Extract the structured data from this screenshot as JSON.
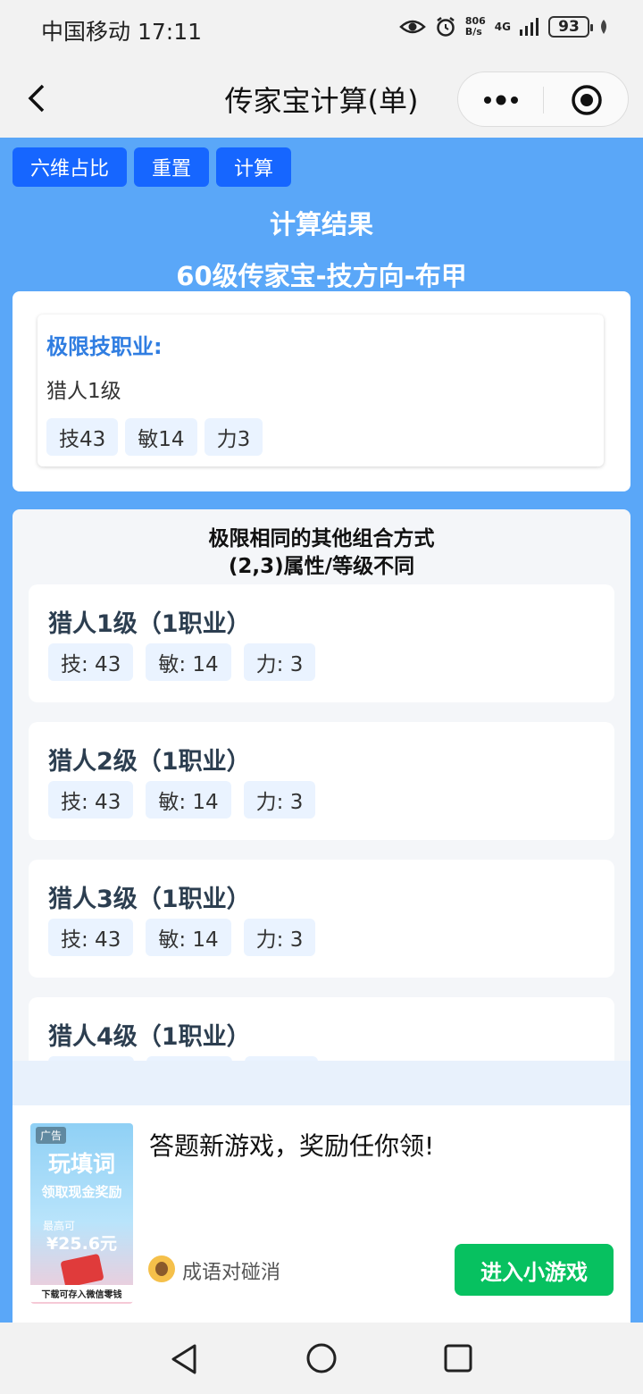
{
  "status_bar": {
    "carrier": "中国移动",
    "time": "17:11",
    "net_speed_value": "806",
    "net_speed_unit": "B/s",
    "network": "4G",
    "battery": "93"
  },
  "title_bar": {
    "title": "传家宝计算(单)"
  },
  "toolbar": {
    "six_dim_label": "六维占比",
    "reset_label": "重置",
    "calc_label": "计算"
  },
  "result": {
    "title": "计算结果",
    "subtitle": "60级传家宝-技方向-布甲"
  },
  "extreme": {
    "label": "极限技职业:",
    "class_name": "猎人1级",
    "stats": [
      "技43",
      "敏14",
      "力3"
    ]
  },
  "combos": {
    "title_line1": "极限相同的其他组合方式",
    "title_line2": "(2,3)属性/等级不同",
    "items": [
      {
        "name": "猎人1级（1职业）",
        "stats": [
          "技: 43",
          "敏: 14",
          "力: 3"
        ]
      },
      {
        "name": "猎人2级（1职业）",
        "stats": [
          "技: 43",
          "敏: 14",
          "力: 3"
        ]
      },
      {
        "name": "猎人3级（1职业）",
        "stats": [
          "技: 43",
          "敏: 14",
          "力: 3"
        ]
      },
      {
        "name": "猎人4级（1职业）",
        "stats": [
          "",
          "",
          ""
        ]
      }
    ]
  },
  "ad": {
    "badge": "广告",
    "image_title": "玩填词",
    "image_subtitle": "领取现金奖励",
    "image_max_label": "最高可",
    "image_amount": "¥25.6元",
    "image_footer": "下载可存入微信零钱",
    "headline": "答题新游戏，奖励任你领!",
    "brand_name": "成语对碰消",
    "cta_label": "进入小游戏"
  },
  "colors": {
    "primary_button": "#1666ff",
    "page_background": "#5aa7f8",
    "accent_label": "#2f7de1",
    "cta_green": "#07c160"
  }
}
